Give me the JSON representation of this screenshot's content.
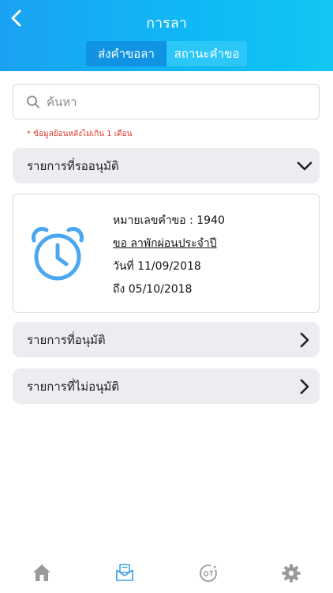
{
  "header": {
    "title": "การลา",
    "tabs": [
      {
        "label": "ส่งคำขอลา",
        "active": false
      },
      {
        "label": "สถานะคำขอ",
        "active": true
      }
    ]
  },
  "search": {
    "placeholder": "ค้นหา"
  },
  "note": "* ข้อมูลย้อนหลังไม่เกิน 1 เดือน",
  "sections": {
    "pending": {
      "label": "รายการที่รออนุมัติ",
      "expanded": true
    },
    "approved": {
      "label": "รายการที่อนุมัติ"
    },
    "rejected": {
      "label": "รายการที่ไม่อนุมัติ"
    }
  },
  "pending_item": {
    "request_no": "หมายเลขคำขอ : 1940",
    "leave_type": "ขอ ลาพักผ่อนประจำปี",
    "date_from": "วันที่ 11/09/2018",
    "date_to": "ถึง 05/10/2018",
    "icon": "alarm-clock-icon"
  },
  "colors": {
    "header_start": "#1aa2f2",
    "header_end": "#11c7f4",
    "tab_active": "#2cc6f8",
    "tab_inactive": "#0f93e2",
    "clock": "#4aa7f0",
    "note": "#e0382e",
    "section_bg": "#ececf1"
  },
  "bottom_nav": [
    {
      "icon": "home-icon"
    },
    {
      "icon": "leave-mail-icon",
      "active": true
    },
    {
      "icon": "ot-icon"
    },
    {
      "icon": "gear-icon"
    }
  ]
}
